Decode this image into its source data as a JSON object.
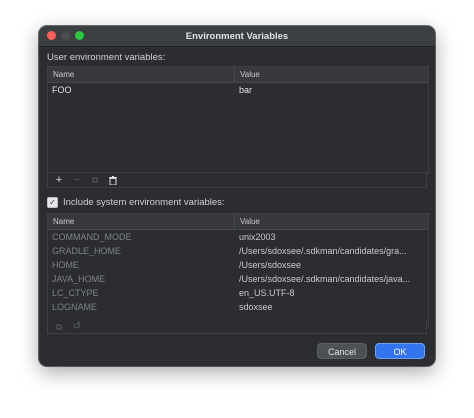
{
  "dialog": {
    "title": "Environment Variables",
    "user_section_label": "User environment variables:",
    "user_table": {
      "headers": [
        "Name",
        "Value"
      ],
      "rows": [
        {
          "name": "FOO",
          "value": "bar"
        }
      ]
    },
    "toolbar": {
      "add_icon": "+",
      "remove_icon": "−",
      "copy_icon": "⧉",
      "delete_icon": "🗑"
    },
    "include_system": {
      "checked": true,
      "check_glyph": "✓",
      "label": "Include system environment variables:"
    },
    "system_table": {
      "headers": [
        "Name",
        "Value"
      ],
      "rows": [
        {
          "name": "COMMAND_MODE",
          "value": "unix2003"
        },
        {
          "name": "GRADLE_HOME",
          "value": "/Users/sdoxsee/.sdkman/candidates/gra..."
        },
        {
          "name": "HOME",
          "value": "/Users/sdoxsee"
        },
        {
          "name": "JAVA_HOME",
          "value": "/Users/sdoxsee/.sdkman/candidates/java..."
        },
        {
          "name": "LC_CTYPE",
          "value": "en_US.UTF-8"
        },
        {
          "name": "LOGNAME",
          "value": "sdoxsee"
        }
      ]
    },
    "system_toolbar": {
      "copy_icon": "⧉",
      "reset_icon": "↺"
    },
    "buttons": {
      "cancel": "Cancel",
      "ok": "OK"
    }
  }
}
